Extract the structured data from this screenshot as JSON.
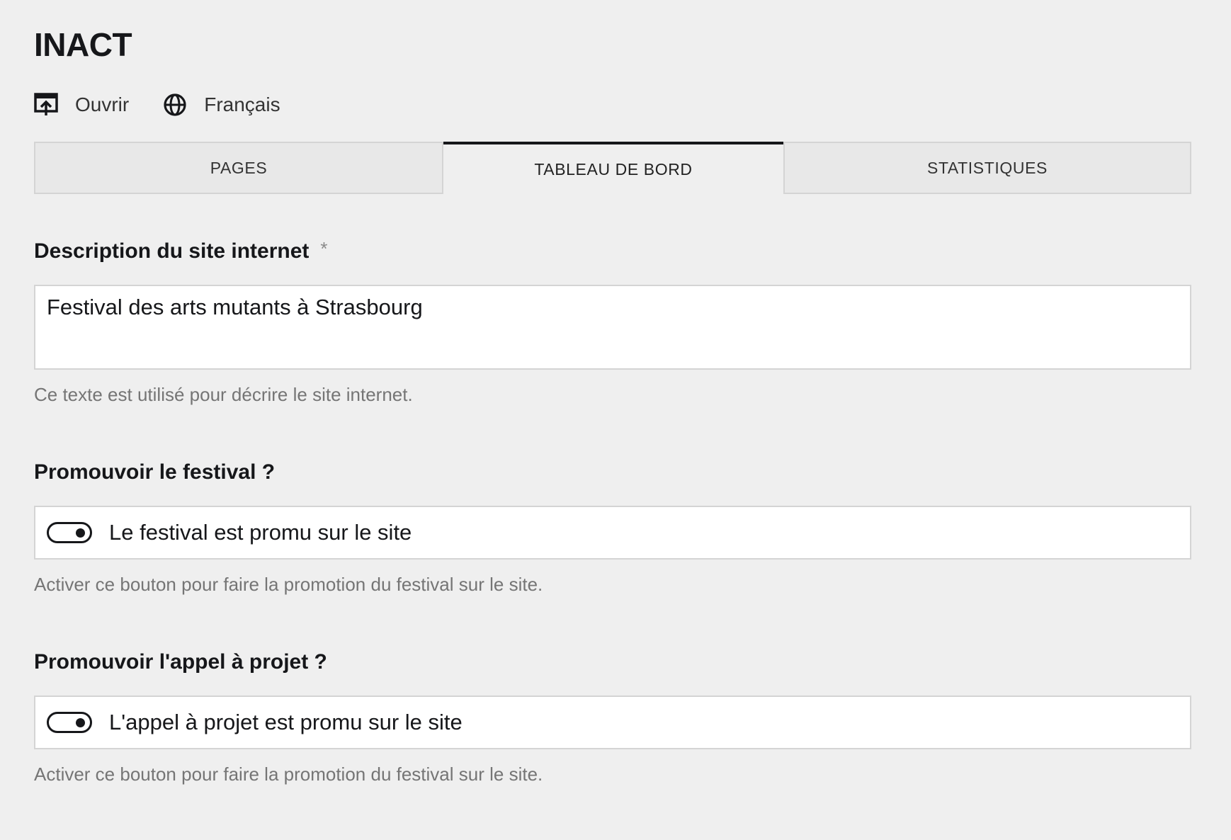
{
  "site": {
    "title": "INACT"
  },
  "header": {
    "open_label": "Ouvrir",
    "open_icon": "open-external-icon",
    "language_label": "Français",
    "language_icon": "globe-icon"
  },
  "tabs": [
    {
      "label": "PAGES",
      "active": false
    },
    {
      "label": "TABLEAU DE BORD",
      "active": true
    },
    {
      "label": "STATISTIQUES",
      "active": false
    }
  ],
  "fields": {
    "description": {
      "label": "Description du site internet",
      "required_marker": "*",
      "value": "Festival des arts mutants à Strasbourg",
      "help": "Ce texte est utilisé pour décrire le site internet."
    },
    "promote_festival": {
      "label": "Promouvoir le festival ?",
      "toggle_text": "Le festival est promu sur le site",
      "toggle_on": true,
      "help": "Activer ce bouton pour faire la promotion du festival sur le site."
    },
    "promote_call": {
      "label": "Promouvoir l'appel à projet ?",
      "toggle_text": "L'appel à projet est promu sur le site",
      "toggle_on": true,
      "help": "Activer ce bouton pour faire la promotion du festival sur le site."
    }
  },
  "colors": {
    "background": "#efefef",
    "text": "#16171a",
    "help_text": "#757575",
    "border": "#d4d4d4",
    "active_tab_indicator": "#16171a"
  }
}
